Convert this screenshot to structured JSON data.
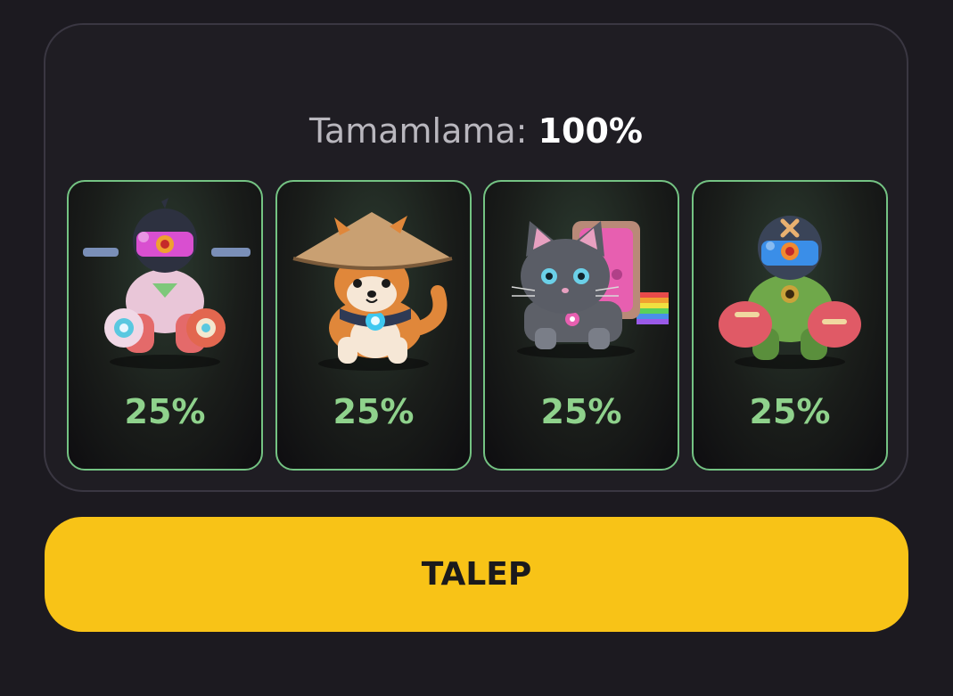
{
  "progress": {
    "label": "Tamamlama:",
    "value": "100%"
  },
  "cards": [
    {
      "icon": "pink-robot-mech-icon",
      "percent": "25%"
    },
    {
      "icon": "shiba-dog-straw-hat-icon",
      "percent": "25%"
    },
    {
      "icon": "gray-cat-rainbow-icon",
      "percent": "25%"
    },
    {
      "icon": "green-robot-mech-icon",
      "percent": "25%"
    }
  ],
  "claim_button": {
    "label": "TALEP"
  },
  "colors": {
    "background": "#1c1a20",
    "card_border": "#74c383",
    "percent_text": "#8fd28c",
    "button": "#f8c317"
  }
}
